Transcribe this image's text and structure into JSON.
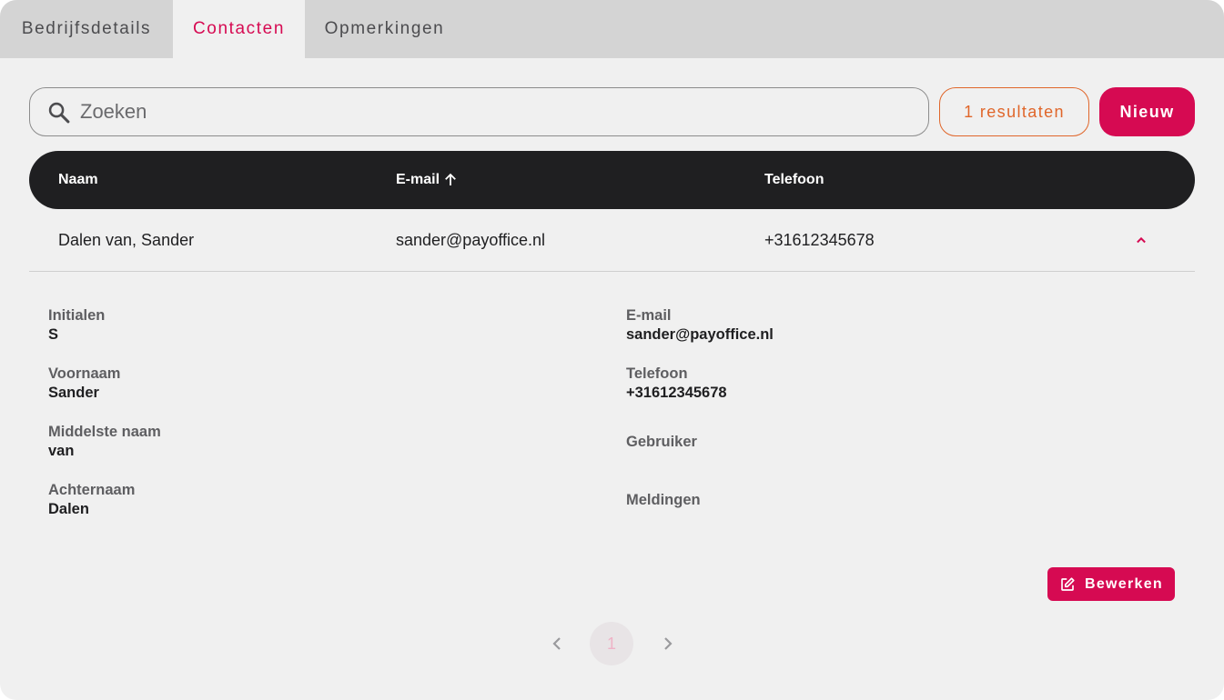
{
  "tabs": [
    {
      "label": "Bedrijfsdetails",
      "active": false
    },
    {
      "label": "Contacten",
      "active": true
    },
    {
      "label": "Opmerkingen",
      "active": false
    }
  ],
  "search": {
    "placeholder": "Zoeken",
    "value": ""
  },
  "results_label": "1 resultaten",
  "new_button_label": "Nieuw",
  "table": {
    "headers": {
      "name": "Naam",
      "email": "E-mail",
      "phone": "Telefoon"
    },
    "sort": {
      "column": "E-mail",
      "direction": "ascending",
      "icon": "arrow-up-icon"
    },
    "rows": [
      {
        "name": "Dalen van, Sander",
        "email": "sander@payoffice.nl",
        "phone": "+31612345678",
        "expanded": true
      }
    ]
  },
  "details": {
    "left": [
      {
        "label": "Initialen",
        "value": "S"
      },
      {
        "label": "Voornaam",
        "value": "Sander"
      },
      {
        "label": "Middelste naam",
        "value": "van"
      },
      {
        "label": "Achternaam",
        "value": "Dalen"
      }
    ],
    "right": [
      {
        "label": "E-mail",
        "value": "sander@payoffice.nl"
      },
      {
        "label": "Telefoon",
        "value": "+31612345678"
      },
      {
        "label": "Gebruiker",
        "value": ""
      },
      {
        "label": "Meldingen",
        "value": ""
      }
    ]
  },
  "edit_button_label": "Bewerken",
  "pagination": {
    "current_page": "1"
  },
  "colors": {
    "accent": "#d60a52",
    "results_accent": "#e0662a",
    "header_bg": "#1f1f21",
    "tabbar_bg": "#d4d4d4",
    "page_bg": "#f0f0f0"
  }
}
